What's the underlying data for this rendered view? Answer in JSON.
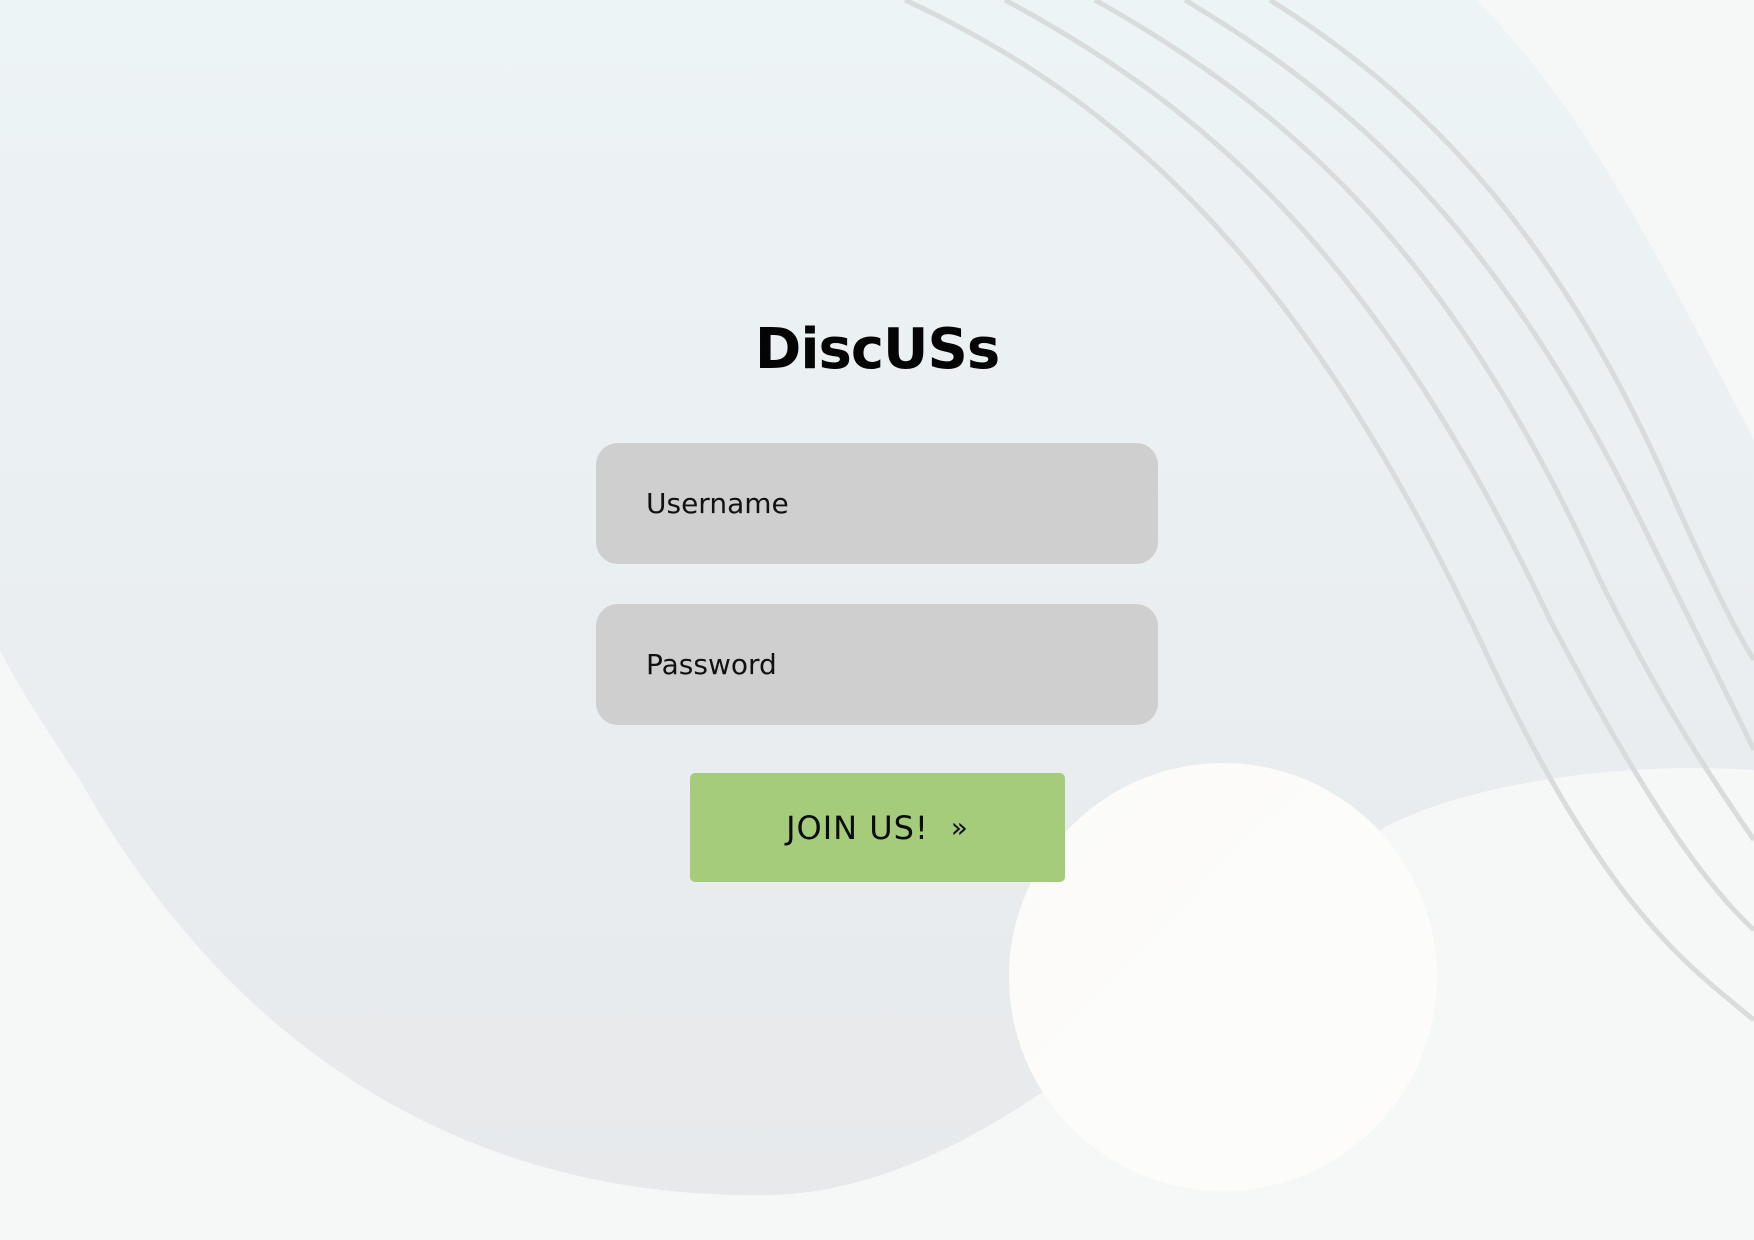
{
  "app": {
    "title": "DiscUSs"
  },
  "form": {
    "username_placeholder": "Username",
    "username_value": "",
    "password_placeholder": "Password",
    "password_value": "",
    "submit_label": "JOIN US!",
    "submit_icon": "»"
  },
  "colors": {
    "input_background": "#cfcfcf",
    "button_background": "#a4cc7a",
    "title_text": "#050505",
    "page_background": "#f6f7f7"
  }
}
